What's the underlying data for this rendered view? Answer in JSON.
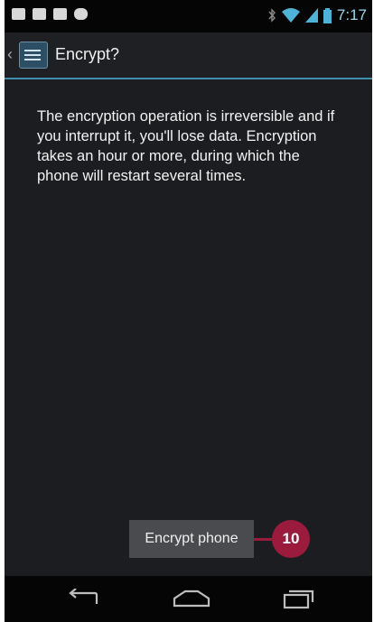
{
  "status_bar": {
    "time": "7:17",
    "left_icons": [
      "mail-icon",
      "chat-icon",
      "video-icon",
      "game-controller-icon"
    ],
    "right_icons": [
      "bluetooth-icon",
      "wifi-icon",
      "signal-icon",
      "battery-icon"
    ]
  },
  "action_bar": {
    "title": "Encrypt?",
    "up_icon": "chevron-left-icon",
    "app_icon": "settings-icon"
  },
  "dialog": {
    "message": "The encryption operation is irreversible and if you interrupt it, you'll lose data. Encryption takes an hour or more, during which the phone will restart several times."
  },
  "button": {
    "label": "Encrypt phone"
  },
  "callout": {
    "label": "10",
    "color": "#9b1b3c"
  },
  "nav_bar": {
    "icons": [
      "back-icon",
      "home-icon",
      "recent-apps-icon"
    ]
  },
  "colors": {
    "accent": "#3d8fad",
    "background": "#1c1d20"
  }
}
